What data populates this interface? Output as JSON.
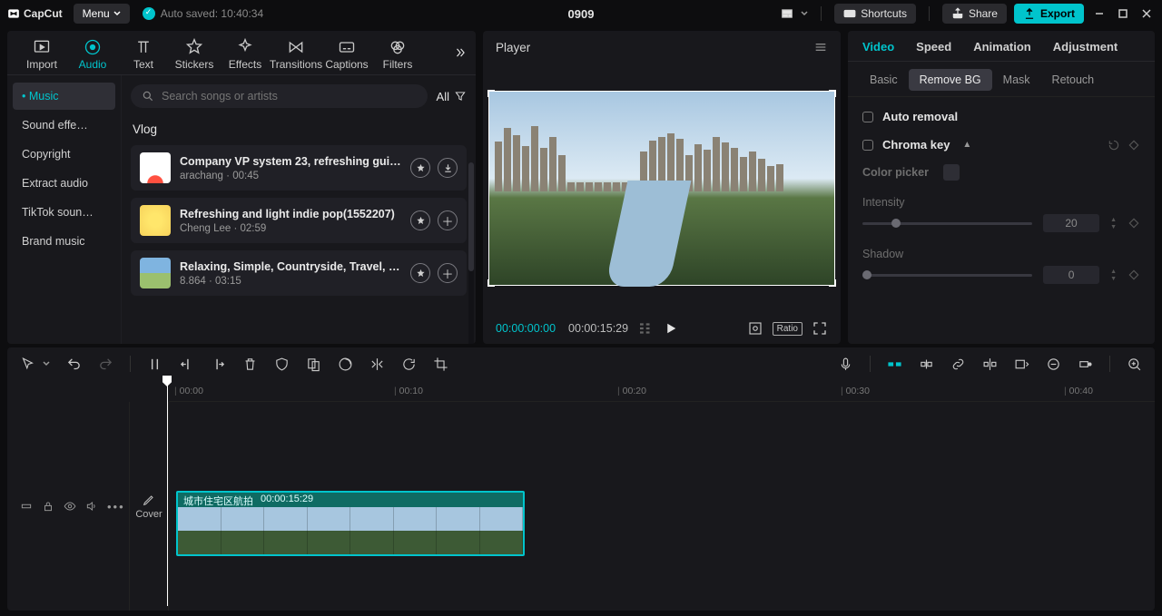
{
  "app": {
    "name": "CapCut"
  },
  "titleBar": {
    "menu": "Menu",
    "autosave": "Auto saved: 10:40:34",
    "project": "0909",
    "shortcuts": "Shortcuts",
    "share": "Share",
    "export": "Export"
  },
  "mediaTabs": {
    "items": [
      {
        "label": "Import"
      },
      {
        "label": "Audio"
      },
      {
        "label": "Text"
      },
      {
        "label": "Stickers"
      },
      {
        "label": "Effects"
      },
      {
        "label": "Transitions"
      },
      {
        "label": "Captions"
      },
      {
        "label": "Filters"
      }
    ]
  },
  "audioSide": {
    "items": [
      {
        "label": "Music"
      },
      {
        "label": "Sound effe…"
      },
      {
        "label": "Copyright"
      },
      {
        "label": "Extract audio"
      },
      {
        "label": "TikTok soun…"
      },
      {
        "label": "Brand music"
      }
    ]
  },
  "search": {
    "placeholder": "Search songs or artists",
    "filter": "All"
  },
  "section": {
    "title": "Vlog"
  },
  "tracks": [
    {
      "title": "Company VP system 23, refreshing guita…",
      "artist": "arachang",
      "dur": "00:45"
    },
    {
      "title": "Refreshing and light indie pop(1552207)",
      "artist": "Cheng Lee",
      "dur": "02:59"
    },
    {
      "title": "Relaxing, Simple, Countryside, Travel, N…",
      "artist": "8.864",
      "dur": "03:15"
    }
  ],
  "player": {
    "title": "Player",
    "current": "00:00:00:00",
    "duration": "00:00:15:29",
    "ratio": "Ratio"
  },
  "inspector": {
    "tabs": [
      {
        "label": "Video"
      },
      {
        "label": "Speed"
      },
      {
        "label": "Animation"
      },
      {
        "label": "Adjustment"
      }
    ],
    "sub": [
      {
        "label": "Basic"
      },
      {
        "label": "Remove BG"
      },
      {
        "label": "Mask"
      },
      {
        "label": "Retouch"
      }
    ],
    "sections": {
      "autoRemoval": "Auto removal",
      "chromaKey": "Chroma key",
      "colorPicker": "Color picker",
      "intensity": "Intensity",
      "intensityValue": "20",
      "shadow": "Shadow",
      "shadowValue": "0"
    }
  },
  "timeline": {
    "ruler": [
      "00:00",
      "00:10",
      "00:20",
      "00:30",
      "00:40"
    ],
    "cover": "Cover",
    "clip": {
      "name": "城市住宅区航拍",
      "dur": "00:00:15:29"
    }
  }
}
